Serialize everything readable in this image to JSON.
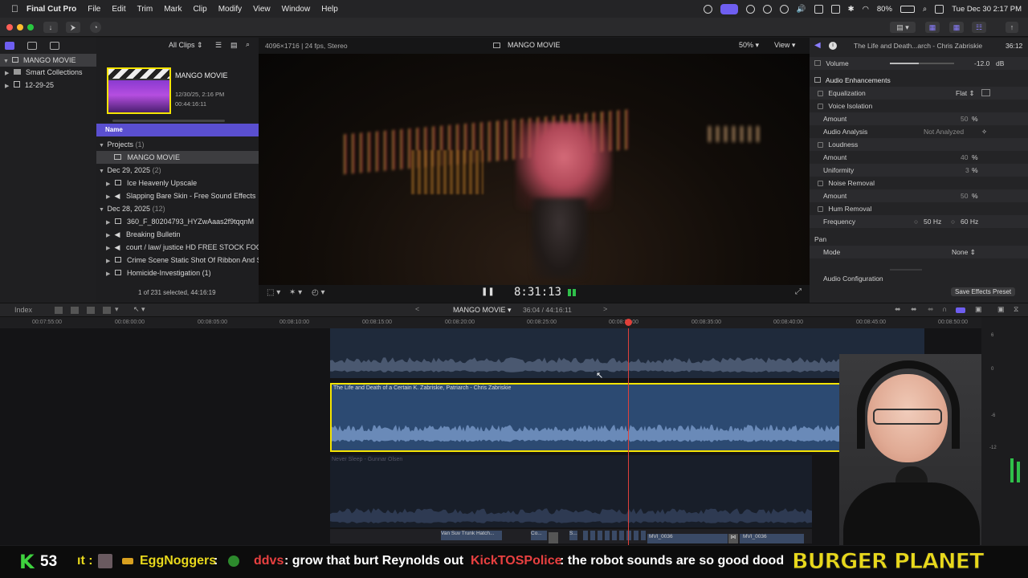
{
  "menubar": {
    "apple": "",
    "app_name": "Final Cut Pro",
    "items": [
      "File",
      "Edit",
      "Trim",
      "Mark",
      "Clip",
      "Modify",
      "View",
      "Window",
      "Help"
    ],
    "battery": "80%",
    "datetime": "Tue Dec 30  2:17 PM"
  },
  "library": {
    "name": "MANGO MOVIE",
    "items": [
      {
        "label": "Smart Collections"
      },
      {
        "label": "12-29-25"
      }
    ]
  },
  "browser": {
    "filter": "All Clips",
    "thumb_title": "MANGO MOVIE",
    "thumb_date": "12/30/25, 2:16 PM",
    "thumb_duration": "00:44:16:11",
    "column_header": "Name",
    "groups": [
      {
        "label": "Projects",
        "count": "(1)",
        "items": [
          "MANGO MOVIE"
        ]
      },
      {
        "label": "Dec 29, 2025",
        "count": "(2)",
        "items": [
          "Ice Heavenly Upscale",
          "Slapping Bare Skin - Free Sound Effects"
        ]
      },
      {
        "label": "Dec 28, 2025",
        "count": "(12)",
        "items": [
          "360_F_80204793_HYZwAaas2f9tqqnM",
          "Breaking Bulletin",
          "court / law/ justice HD FREE STOCK FOO",
          "Crime Scene Static Shot Of Ribbon And S",
          "Homicide-Investigation (1)"
        ]
      }
    ],
    "selection_status": "1 of 231 selected, 44:16:19"
  },
  "viewer": {
    "format": "4096×1716 | 24 fps, Stereo",
    "title": "MANGO MOVIE",
    "zoom": "50%",
    "view_label": "View",
    "timecode": "8:31:13"
  },
  "inspector": {
    "clip_title": "The Life and Death...arch - Chris Zabriskie",
    "duration": "36:12",
    "volume_label": "Volume",
    "volume_value": "-12.0",
    "volume_unit": "dB",
    "volume_level": 0.45,
    "section": "Audio Enhancements",
    "equalization": "Equalization",
    "eq_value": "Flat",
    "voice_isolation": "Voice Isolation",
    "amount": "Amount",
    "vi_amount": "50",
    "pct": "%",
    "audio_analysis": "Audio Analysis",
    "analysis_value": "Not Analyzed",
    "loudness": "Loudness",
    "loud_amount": "40",
    "uniformity": "Uniformity",
    "uniformity_value": "3",
    "noise_removal": "Noise Removal",
    "nr_amount": "50",
    "hum_removal": "Hum Removal",
    "frequency": "Frequency",
    "freq_50": "50 Hz",
    "freq_60": "60 Hz",
    "pan": "Pan",
    "mode": "Mode",
    "mode_value": "None",
    "audio_config": "Audio Configuration",
    "save_preset": "Save Effects Preset"
  },
  "timeline": {
    "index": "Index",
    "project": "MANGO MOVIE",
    "position": "36:04 / 44:16:11",
    "ruler": [
      "00:07:55:00",
      "00:08:00:00",
      "00:08:05:00",
      "00:08:10:00",
      "00:08:15:00",
      "00:08:20:00",
      "00:08:25:00",
      "00:08:30:00",
      "00:08:35:00",
      "00:08:40:00",
      "00:08:45:00",
      "00:08:50:00"
    ],
    "clip_selected": "The Life and Death of a Certain K. Zabriskie, Patriarch - Chris Zabriskie",
    "clip_below": "Never Sleep - Gunnar Olsen",
    "story_clips": [
      "Van Suv Trunk Hatch...",
      "Co...",
      "S...",
      "MVI_0036",
      "MVI_0036"
    ],
    "meter_labels": [
      "6",
      "0",
      "-6",
      "-12"
    ]
  },
  "chat": {
    "k_count": "53",
    "messages": [
      {
        "user": "EggNoggers",
        "text": ""
      },
      {
        "user": "ddvs",
        "text": ": grow that burt Reynolds out"
      },
      {
        "user": "KickTOSPolice",
        "text": ": the robot sounds are so good dood"
      }
    ],
    "prefix": "ıt :",
    "brand": "BURGER PLANET"
  },
  "colors": {
    "accent": "#6e5ef0",
    "selection": "#f5e400",
    "playhead": "#e0403a",
    "audio_clip": "#2c4a72",
    "chat_green": "#3ed23e",
    "chat_yellow": "#e8d81c",
    "chat_red": "#e84040"
  }
}
